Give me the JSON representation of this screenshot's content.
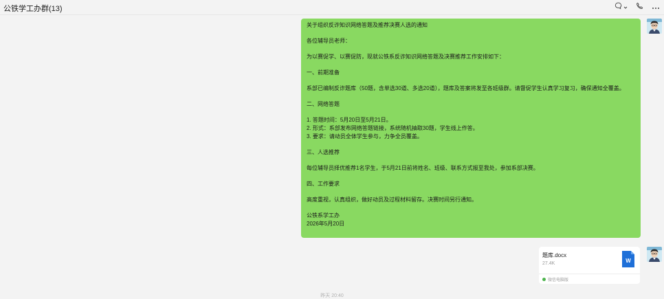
{
  "window": {
    "title": "公铁学工办群(13)",
    "icons": [
      "chat-bubble-icon",
      "chevron-down-icon",
      "phone-icon",
      "more-icon"
    ]
  },
  "message": {
    "lines": [
      "关于组织反诈知识网络答题及推荐决赛人选的通知",
      "各位辅导员老师：",
      "为以赛促学、以赛促防，现就公铁系反诈知识网络答题及决赛推荐工作安排如下：",
      "一、前期准备",
      "系部已编制反诈题库（50题，含单选30道、多选20道），题库及答案将发至各班级群。请督促学生认真学习复习，确保通知全覆盖。",
      "二、网络答题",
      "1. 答题时间：5月20日至5月21日。",
      "2. 形式：系部发布网络答题链接，系统随机抽取30题，学生线上作答。",
      "3. 要求：请动员全体学生参与，力争全员覆盖。",
      "三、人选推荐",
      "每位辅导员择优推荐1名学生，于5月21日前将姓名、班级、联系方式报至我处，参加系部决赛。",
      "四、工作要求",
      "高度重视，认真组织，做好动员及过程材料留存。决赛时间另行通知。",
      "公铁系学工办",
      "2026年5月20日"
    ]
  },
  "file": {
    "name": "题库.docx",
    "size": "27.4K",
    "source": "微信电脑版",
    "icon_letter": "W",
    "icon": "word-file-icon"
  },
  "bottom_time": "昨天 20:40",
  "colors": {
    "bubble": "#89d961",
    "background": "#f3f3f3",
    "word_blue": "#1e6fd8"
  }
}
